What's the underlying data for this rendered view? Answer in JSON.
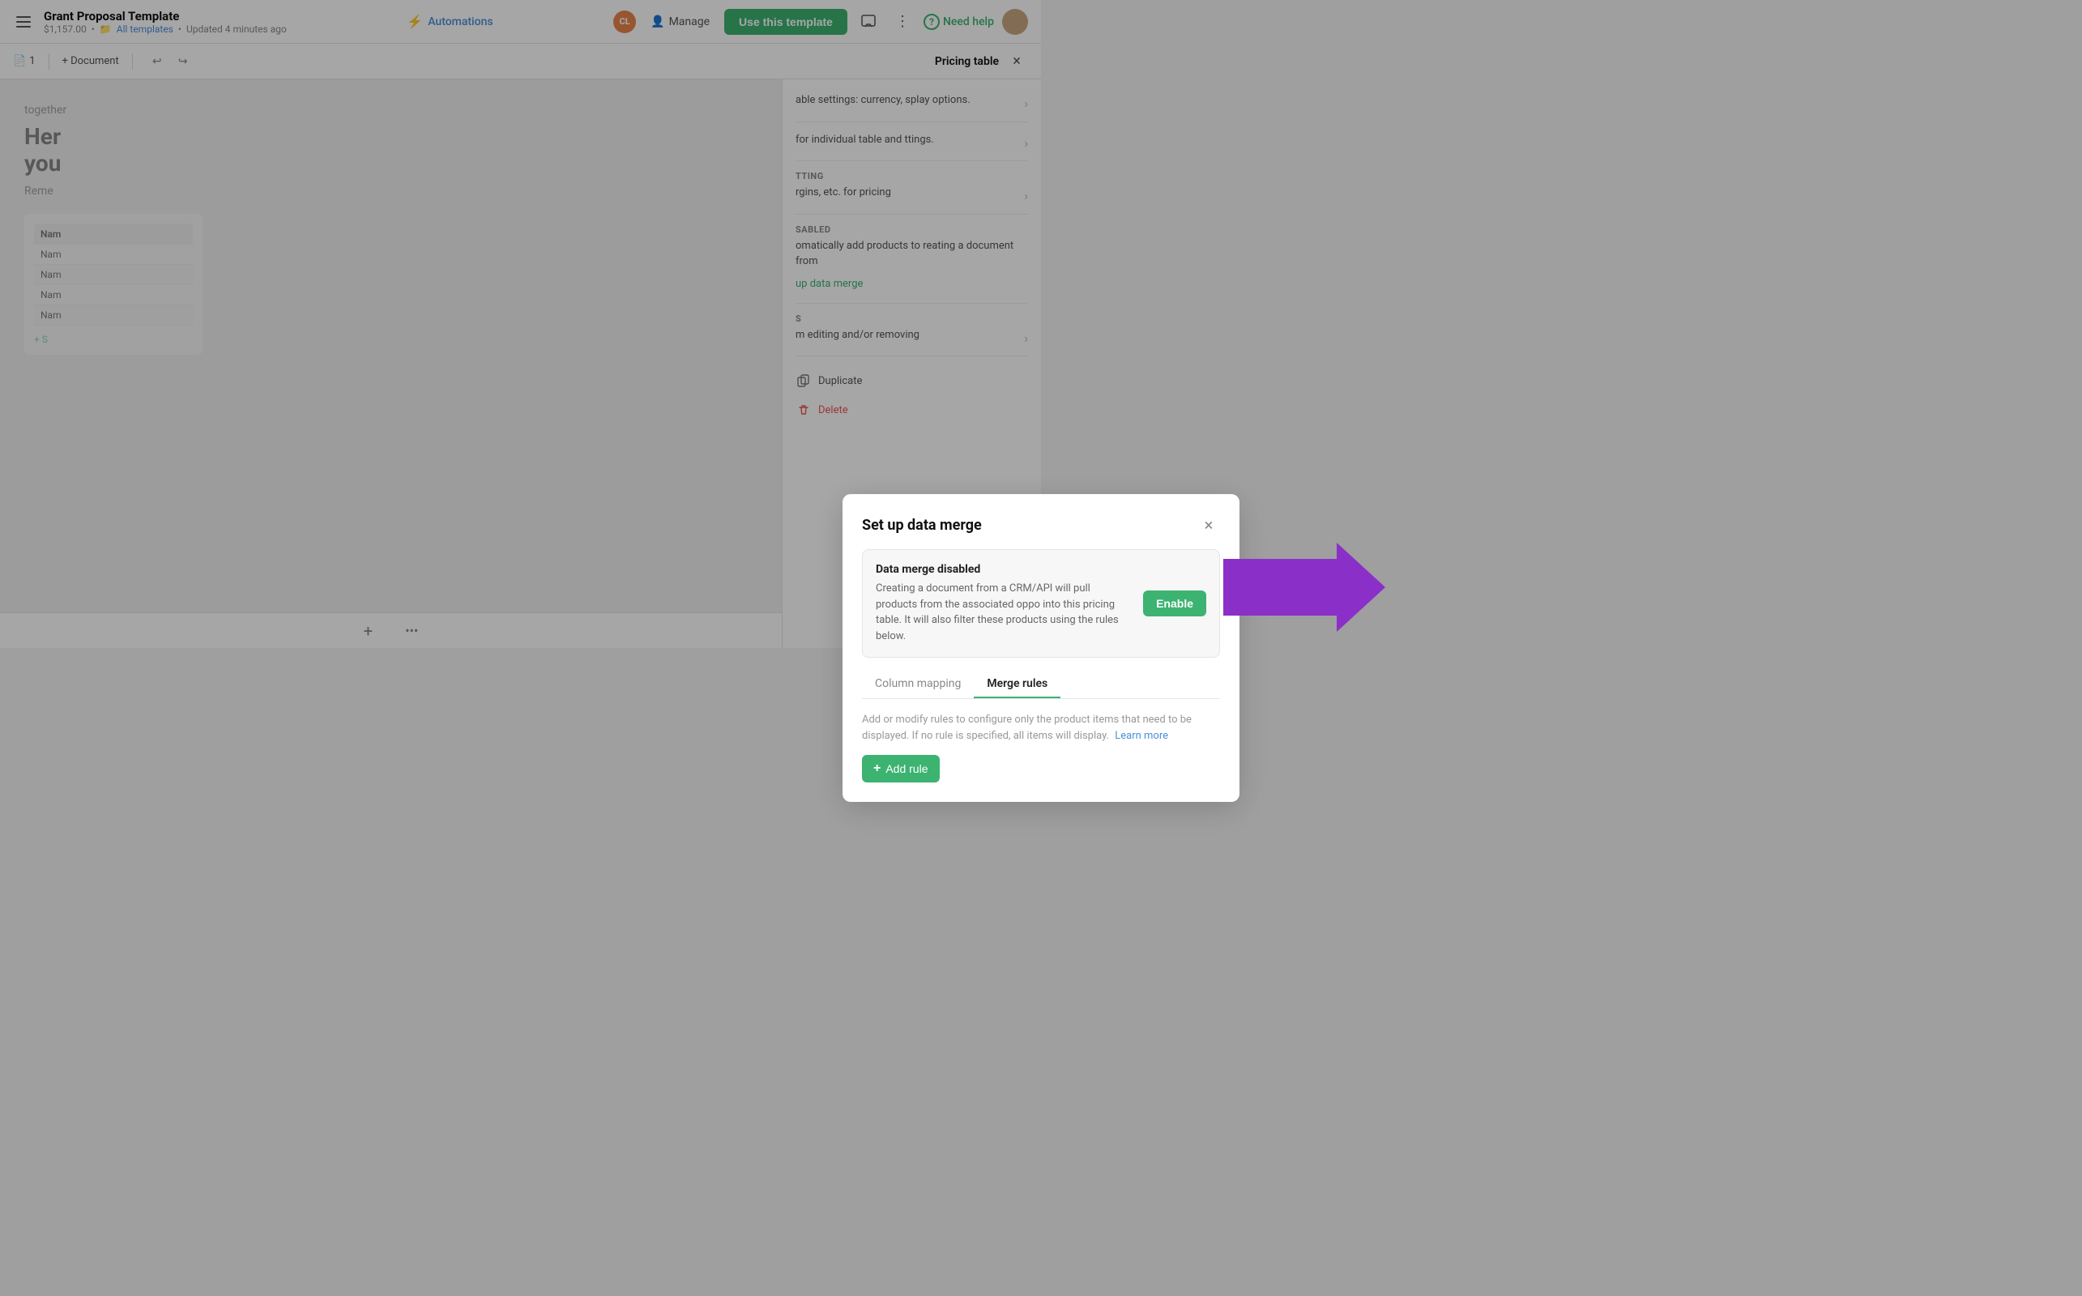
{
  "header": {
    "hamburger_label": "menu",
    "title": "Grant Proposal Template",
    "price": "$1,157.00",
    "meta_sep1": "•",
    "folder_icon": "📁",
    "all_templates": "All templates",
    "meta_sep2": "•",
    "updated": "Updated 4 minutes ago",
    "automations_label": "Automations",
    "avatar_cl": "CL",
    "manage_label": "Manage",
    "use_template_label": "Use this template",
    "more_icon": "⋮",
    "help_icon": "?",
    "need_help_label": "Need help"
  },
  "toolbar": {
    "page_number": "1",
    "add_document_label": "+ Document",
    "pricing_table_panel": "Pricing table"
  },
  "doc_content": {
    "together_text": "together",
    "heading_line1": "Her",
    "heading_line2": "you",
    "reme_text": "Reme",
    "table_header": "Nam",
    "rows": [
      "Nam",
      "Nam",
      "Nam",
      "Nam"
    ],
    "add_section": "+ S"
  },
  "right_panel": {
    "sections": [
      {
        "text": "able settings: currency, splay options."
      },
      {
        "text": "for individual table and ttings."
      },
      {
        "label": "TTING",
        "text": "rgins, etc. for pricing"
      },
      {
        "label": "SABLED",
        "text": "omatically add products to reating a document from"
      },
      {
        "link_text": "up data merge"
      },
      {
        "label": "S",
        "text": "m editing and/or removing"
      }
    ],
    "duplicate_label": "Duplicate",
    "delete_label": "Delete"
  },
  "modal": {
    "title": "Set up data merge",
    "close_icon": "×",
    "banner": {
      "heading": "Data merge disabled",
      "description": "Creating a document from a CRM/API will pull products from the associated oppo into this pricing table. It will also filter these products using the rules below.",
      "enable_label": "Enable"
    },
    "tabs": [
      {
        "label": "Column mapping",
        "active": false
      },
      {
        "label": "Merge rules",
        "active": true
      }
    ],
    "rules_desc_part1": "Add or modify rules to configure only the product items that need to be displayed. If no rule is specified, all items will display.",
    "learn_more_label": "Learn more",
    "add_rule_label": "Add rule"
  },
  "colors": {
    "green": "#3cb371",
    "blue": "#4a90d9",
    "purple": "#7b2d8b",
    "arrow_purple": "#8B2FC9"
  }
}
